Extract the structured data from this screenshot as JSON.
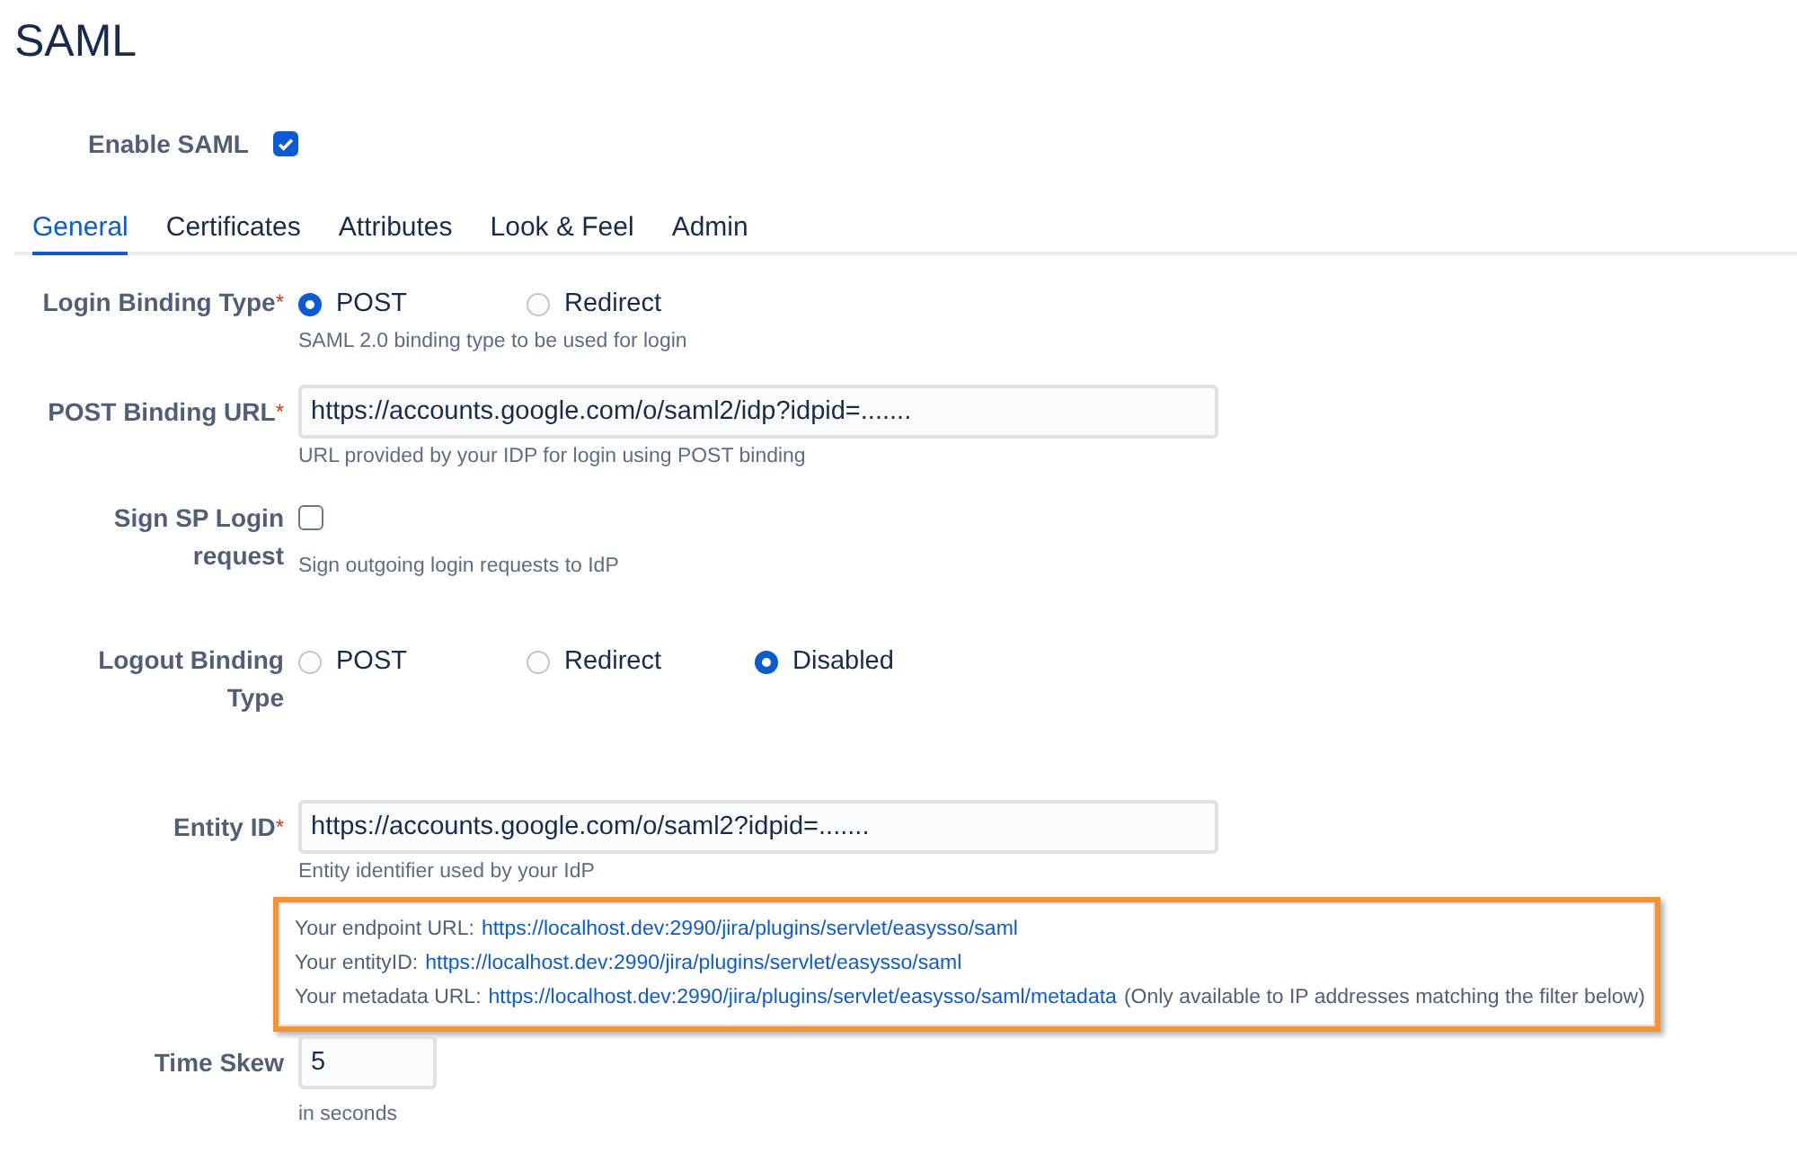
{
  "title": "SAML",
  "enable": {
    "label": "Enable SAML",
    "checked": true
  },
  "tabs": [
    {
      "label": "General",
      "selected": true
    },
    {
      "label": "Certificates",
      "selected": false
    },
    {
      "label": "Attributes",
      "selected": false
    },
    {
      "label": "Look & Feel",
      "selected": false
    },
    {
      "label": "Admin",
      "selected": false
    }
  ],
  "fields": [
    {
      "kind": "radio",
      "label": "Login Binding Type",
      "required_mark": "*",
      "options": [
        {
          "label": "POST",
          "selected": true
        },
        {
          "label": "Redirect",
          "selected": false
        }
      ],
      "help": "SAML 2.0 binding type to be used for login"
    },
    {
      "kind": "text",
      "label": "POST Binding URL",
      "required_mark": "*",
      "value": "https://accounts.google.com/o/saml2/idp?idpid=.......",
      "help": "URL provided by your IDP for login using POST binding"
    },
    {
      "kind": "checkbox",
      "label": "Sign SP Login request",
      "checked": false,
      "help": "Sign outgoing login requests to IdP"
    },
    {
      "kind": "radio",
      "label": "Logout Binding Type",
      "options": [
        {
          "label": "POST",
          "selected": false
        },
        {
          "label": "Redirect",
          "selected": false
        },
        {
          "label": "Disabled",
          "selected": true
        }
      ]
    },
    {
      "kind": "text",
      "label": "Entity ID",
      "required_mark": "*",
      "value": "https://accounts.google.com/o/saml2?idpid=.......",
      "help": "Entity identifier used by your IdP"
    },
    {
      "kind": "info",
      "lines": [
        {
          "text": "Your endpoint URL:",
          "link": "https://localhost.dev:2990/jira/plugins/servlet/easysso/saml"
        },
        {
          "text": "Your entityID:",
          "link": "https://localhost.dev:2990/jira/plugins/servlet/easysso/saml"
        },
        {
          "text": "Your metadata URL:",
          "link": "https://localhost.dev:2990/jira/plugins/servlet/easysso/saml/metadata",
          "note": "(Only available to IP addresses matching the filter below)"
        }
      ]
    },
    {
      "kind": "number",
      "label": "Time Skew",
      "value": "5",
      "help": "in seconds"
    }
  ]
}
